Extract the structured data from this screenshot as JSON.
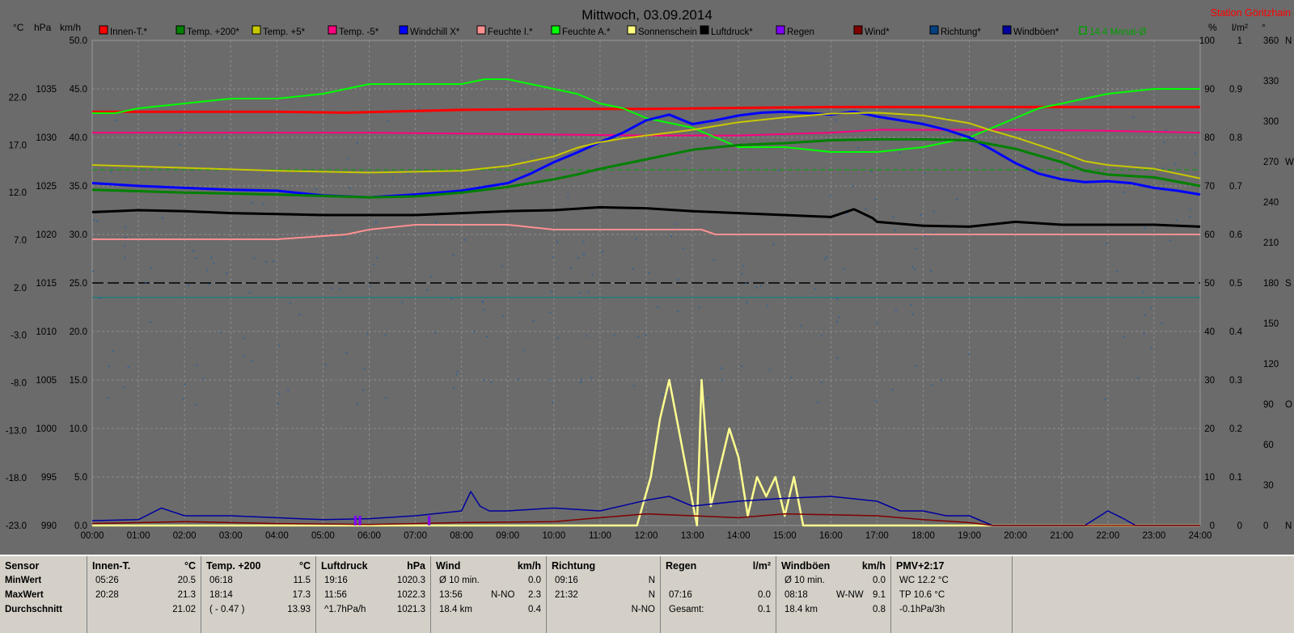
{
  "title": "Mittwoch, 03.09.2014",
  "station": "Station Göritzhain",
  "axis_units": {
    "c": "°C",
    "hpa": "hPa",
    "kmh": "km/h",
    "pct": "%",
    "lm2": "l/m²",
    "deg": "°"
  },
  "legend": [
    {
      "label": "Innen-T.*",
      "color": "#ff0000"
    },
    {
      "label": "Temp. +200*",
      "color": "#008000"
    },
    {
      "label": "Temp. +5*",
      "color": "#c8c800"
    },
    {
      "label": "Temp. -5*",
      "color": "#ff0080"
    },
    {
      "label": "Windchill X*",
      "color": "#0000ff"
    },
    {
      "label": "Feuchte I.*",
      "color": "#ff9090"
    },
    {
      "label": "Feuchte A.*",
      "color": "#00ff00"
    },
    {
      "label": "Sonnenschein",
      "color": "#ffff80"
    },
    {
      "label": "Luftdruck*",
      "color": "#000000"
    },
    {
      "label": "Regen",
      "color": "#8000ff"
    },
    {
      "label": "Wind*",
      "color": "#800000"
    },
    {
      "label": "Richtung*",
      "color": "#004080"
    },
    {
      "label": "Windböen*",
      "color": "#0000a0"
    },
    {
      "label": "14.4 Monat-Ø",
      "color": "#00a000"
    }
  ],
  "chart_data": {
    "type": "line",
    "title": "Mittwoch, 03.09.2014",
    "x_ticks": [
      "00:00",
      "01:00",
      "02:00",
      "03:00",
      "04:00",
      "05:00",
      "06:00",
      "07:00",
      "08:00",
      "09:00",
      "10:00",
      "11:00",
      "12:00",
      "13:00",
      "14:00",
      "15:00",
      "16:00",
      "17:00",
      "18:00",
      "19:00",
      "20:00",
      "21:00",
      "22:00",
      "23:00",
      "24:00"
    ],
    "y_axes": {
      "temp_c": [
        "22.0",
        "17.0",
        "12.0",
        "7.0",
        "2.0",
        "-3.0",
        "-8.0",
        "-13.0",
        "-18.0",
        "-23.0"
      ],
      "pressure_hpa": [
        "1035",
        "1030",
        "1025",
        "1020",
        "1015",
        "1010",
        "1005",
        "1000",
        "995",
        "990"
      ],
      "wind_kmh": [
        "50.0",
        "45.0",
        "40.0",
        "35.0",
        "30.0",
        "25.0",
        "20.0",
        "15.0",
        "10.0",
        "5.0",
        "0.0"
      ],
      "humidity_pct": [
        "100",
        "90",
        "80",
        "70",
        "60",
        "50",
        "40",
        "30",
        "20",
        "10",
        "0"
      ],
      "rain_lm2": [
        "1",
        "0.9",
        "0.8",
        "0.7",
        "0.6",
        "0.5",
        "0.4",
        "0.3",
        "0.2",
        "0.1",
        "0"
      ],
      "direction": [
        {
          "v": "360",
          "d": "N"
        },
        {
          "v": "330",
          "d": ""
        },
        {
          "v": "300",
          "d": ""
        },
        {
          "v": "270",
          "d": "W"
        },
        {
          "v": "240",
          "d": ""
        },
        {
          "v": "210",
          "d": ""
        },
        {
          "v": "180",
          "d": "S"
        },
        {
          "v": "150",
          "d": ""
        },
        {
          "v": "120",
          "d": ""
        },
        {
          "v": "90",
          "d": "O"
        },
        {
          "v": "60",
          "d": ""
        },
        {
          "v": "30",
          "d": ""
        },
        {
          "v": "0",
          "d": "N"
        }
      ]
    },
    "series": [
      {
        "name": "Temp. -5*",
        "unit": "°C",
        "x": [
          0,
          6,
          12,
          14,
          16,
          17,
          18,
          20,
          22,
          24
        ],
        "values": [
          18.3,
          18.3,
          18.0,
          18.0,
          18.3,
          18.6,
          18.6,
          18.6,
          18.5,
          18.3
        ]
      },
      {
        "name": "Innen-T.*",
        "unit": "°C",
        "x": [
          0,
          4,
          5.5,
          8,
          10,
          12,
          14,
          16,
          18,
          20,
          22,
          24
        ],
        "values": [
          20.5,
          20.5,
          20.4,
          20.7,
          20.8,
          20.8,
          20.9,
          21.0,
          21.0,
          21.0,
          21.0,
          21.0
        ]
      },
      {
        "name": "Feuchte A.*",
        "unit": "%",
        "x": [
          0,
          0.5,
          1,
          2,
          3,
          4,
          5,
          5.5,
          6,
          7,
          8,
          8.5,
          9,
          10,
          10.5,
          11,
          11.5,
          12,
          12.5,
          13,
          13.5,
          14,
          15,
          16,
          17,
          18,
          18.5,
          19,
          19.5,
          20,
          20.5,
          21,
          21.5,
          22,
          23,
          23.5,
          24
        ],
        "values": [
          85,
          85,
          86,
          87,
          88,
          88,
          89,
          90,
          91,
          91,
          91,
          92,
          92,
          90,
          89,
          87,
          86,
          84,
          83,
          82,
          80,
          78,
          78,
          77,
          77,
          78,
          79,
          80,
          82,
          84,
          86,
          87,
          88,
          89,
          90,
          90,
          90
        ]
      },
      {
        "name": "Windchill X*",
        "unit": "°C",
        "x": [
          0,
          1,
          2,
          3,
          4,
          5,
          6,
          7,
          8,
          9,
          9.5,
          10,
          10.5,
          11,
          11.5,
          12,
          12.5,
          13,
          13.5,
          14,
          14.5,
          15,
          16,
          16.5,
          17,
          17.5,
          18,
          18.5,
          19,
          19.5,
          20,
          20.5,
          21,
          21.5,
          22,
          22.5,
          23,
          23.5,
          24
        ],
        "values": [
          13.0,
          12.7,
          12.5,
          12.3,
          12.2,
          11.7,
          11.5,
          11.8,
          12.2,
          13.0,
          14.0,
          15.2,
          16.2,
          17.3,
          18.3,
          19.6,
          20.2,
          19.2,
          19.6,
          20.1,
          20.4,
          20.5,
          20.2,
          20.5,
          20.0,
          19.6,
          19.2,
          18.6,
          17.8,
          16.5,
          15.1,
          14.0,
          13.4,
          13.1,
          13.2,
          13.0,
          12.5,
          12.2,
          11.8
        ]
      },
      {
        "name": "Temp. +5*",
        "unit": "°C",
        "x": [
          0,
          2,
          4,
          6,
          8,
          9,
          10,
          10.5,
          11,
          11.5,
          12,
          12.5,
          13,
          13.5,
          14,
          15,
          16,
          17,
          18,
          19,
          19.5,
          20,
          20.5,
          21,
          21.5,
          22,
          23,
          24
        ],
        "values": [
          14.9,
          14.6,
          14.3,
          14.1,
          14.3,
          14.8,
          15.8,
          16.7,
          17.3,
          17.7,
          18.0,
          18.3,
          18.6,
          19.0,
          19.4,
          19.9,
          20.3,
          20.4,
          20.1,
          19.3,
          18.5,
          17.8,
          17.0,
          16.2,
          15.3,
          14.9,
          14.5,
          13.5
        ]
      },
      {
        "name": "Temp. +200*",
        "unit": "°C",
        "x": [
          0,
          2,
          4,
          6,
          7,
          8,
          9,
          10,
          10.5,
          11,
          12,
          12.5,
          13,
          14,
          15,
          16,
          17,
          18,
          19,
          20,
          20.5,
          21,
          21.5,
          22,
          23,
          24
        ],
        "values": [
          12.3,
          12.0,
          11.8,
          11.5,
          11.6,
          12.0,
          12.6,
          13.4,
          13.9,
          14.5,
          15.5,
          16.0,
          16.5,
          17.0,
          17.2,
          17.5,
          17.6,
          17.6,
          17.5,
          16.6,
          15.9,
          15.2,
          14.3,
          13.9,
          13.6,
          12.7
        ]
      },
      {
        "name": "Luftdruck*",
        "unit": "hPa",
        "x": [
          0,
          1,
          2,
          3,
          4,
          5,
          6,
          7,
          8,
          9,
          10,
          11,
          12,
          13,
          14,
          15,
          16,
          16.5,
          16.9,
          17,
          18,
          19,
          20,
          21,
          22,
          23,
          24
        ],
        "values": [
          1022.3,
          1022.5,
          1022.4,
          1022.2,
          1022.1,
          1022.0,
          1022.0,
          1022.0,
          1022.2,
          1022.4,
          1022.5,
          1022.8,
          1022.7,
          1022.4,
          1022.2,
          1022.0,
          1021.8,
          1022.6,
          1021.7,
          1021.3,
          1020.9,
          1020.8,
          1021.3,
          1021.0,
          1021.0,
          1021.0,
          1020.8
        ]
      },
      {
        "name": "Feuchte I.*",
        "unit": "%",
        "x": [
          0,
          4,
          5.5,
          6,
          7,
          8,
          9,
          10,
          13.2,
          13.5,
          24
        ],
        "values": [
          59,
          59,
          60,
          61,
          62,
          62,
          62,
          61,
          61,
          60,
          60
        ]
      },
      {
        "name": "Sonnenschein",
        "unit": "km/h",
        "x": [
          0,
          11.8,
          12.1,
          12.3,
          12.5,
          12.7,
          12.9,
          13.1,
          13.2,
          13.4,
          13.6,
          13.8,
          14.0,
          14.2,
          14.4,
          14.6,
          14.8,
          15.0,
          15.2,
          15.4,
          24
        ],
        "values": [
          0,
          0,
          5,
          11,
          15,
          10,
          5,
          0,
          15,
          2,
          6,
          10,
          7,
          1,
          5,
          3,
          5,
          1,
          5,
          0,
          0
        ]
      },
      {
        "name": "Windböen*",
        "unit": "km/h",
        "x": [
          0,
          1,
          1.5,
          2,
          3,
          4,
          5,
          6,
          7,
          8,
          8.2,
          8.4,
          8.6,
          9,
          10,
          11,
          12,
          12.5,
          13,
          14,
          15,
          16,
          17,
          17.5,
          18,
          18.5,
          19,
          19.5,
          21.5,
          22,
          22.3,
          22.6,
          24
        ],
        "values": [
          0.5,
          0.6,
          1.8,
          1.0,
          1.0,
          0.8,
          0.6,
          0.7,
          1.0,
          1.5,
          3.5,
          2.0,
          1.5,
          1.5,
          1.8,
          1.5,
          2.6,
          3.0,
          2.0,
          2.5,
          2.8,
          3.0,
          2.5,
          1.5,
          1.5,
          1.0,
          1.0,
          0,
          0,
          1.5,
          0.8,
          0,
          0
        ]
      },
      {
        "name": "Wind*",
        "unit": "km/h",
        "x": [
          0,
          2,
          4,
          6,
          8,
          10,
          11,
          12,
          13,
          14,
          15,
          16,
          17,
          18,
          19,
          19.5,
          24
        ],
        "values": [
          0.2,
          0.4,
          0.2,
          0.1,
          0.3,
          0.4,
          0.8,
          1.2,
          1.0,
          0.8,
          1.2,
          1.1,
          1.0,
          0.6,
          0.3,
          0,
          0
        ]
      },
      {
        "name": "Regen",
        "unit": "l/m²",
        "x": [
          5.7,
          5.8,
          7.3
        ],
        "values": [
          0.01,
          0.01,
          0.01
        ]
      }
    ],
    "reference_lines": [
      {
        "name": "14.4 Monat-Ø",
        "value": 14.4,
        "unit": "°C"
      },
      {
        "name": "Richtung 180",
        "value": 180,
        "unit": "°"
      },
      {
        "name": "Feuchte 47",
        "value": 47,
        "unit": "%"
      }
    ]
  },
  "table": {
    "row_labels": [
      "Sensor",
      "MinWert",
      "MaxWert",
      "Durchschnitt"
    ],
    "columns": [
      {
        "head_l": "Innen-T.",
        "head_r": "°C",
        "rows": [
          [
            "05:26",
            "",
            "20.5"
          ],
          [
            "20:28",
            "",
            "21.3"
          ],
          [
            "",
            "",
            "21.02"
          ]
        ]
      },
      {
        "head_l": "Temp. +200",
        "head_r": "°C",
        "rows": [
          [
            "06:18",
            "",
            "11.5"
          ],
          [
            "18:14",
            "",
            "17.3"
          ],
          [
            "( - 0.47 )",
            "",
            "13.93"
          ]
        ]
      },
      {
        "head_l": "Luftdruck",
        "head_r": "hPa",
        "rows": [
          [
            "19:16",
            "",
            "1020.3"
          ],
          [
            "11:56",
            "",
            "1022.3"
          ],
          [
            "^1.7hPa/h",
            "",
            "1021.3"
          ]
        ]
      },
      {
        "head_l": "Wind",
        "head_r": "km/h",
        "rows": [
          [
            "Ø 10 min.",
            "",
            "0.0"
          ],
          [
            "13:56",
            "N-NO",
            "2.3"
          ],
          [
            "18.4 km",
            "",
            "0.4"
          ]
        ]
      },
      {
        "head_l": "Richtung",
        "head_r": "",
        "rows": [
          [
            "09:16",
            "",
            "N"
          ],
          [
            "21:32",
            "",
            "N"
          ],
          [
            "",
            "",
            "N-NO"
          ]
        ]
      },
      {
        "head_l": "Regen",
        "head_r": "l/m²",
        "rows": [
          [
            "",
            "",
            ""
          ],
          [
            "07:16",
            "",
            "0.0"
          ],
          [
            "Gesamt:",
            "",
            "0.1"
          ]
        ]
      },
      {
        "head_l": "Windböen",
        "head_r": "km/h",
        "rows": [
          [
            "Ø 10 min.",
            "",
            "0.0"
          ],
          [
            "08:18",
            "W-NW",
            "9.1"
          ],
          [
            "18.4 km",
            "",
            "0.8"
          ]
        ]
      },
      {
        "head_l": "PMV+2:17",
        "head_r": "",
        "rows": [
          [
            "WC 12.2 °C",
            "",
            ""
          ],
          [
            "TP 10.6 °C",
            "",
            ""
          ],
          [
            "-0.1hPa/3h",
            "",
            ""
          ]
        ]
      }
    ]
  }
}
